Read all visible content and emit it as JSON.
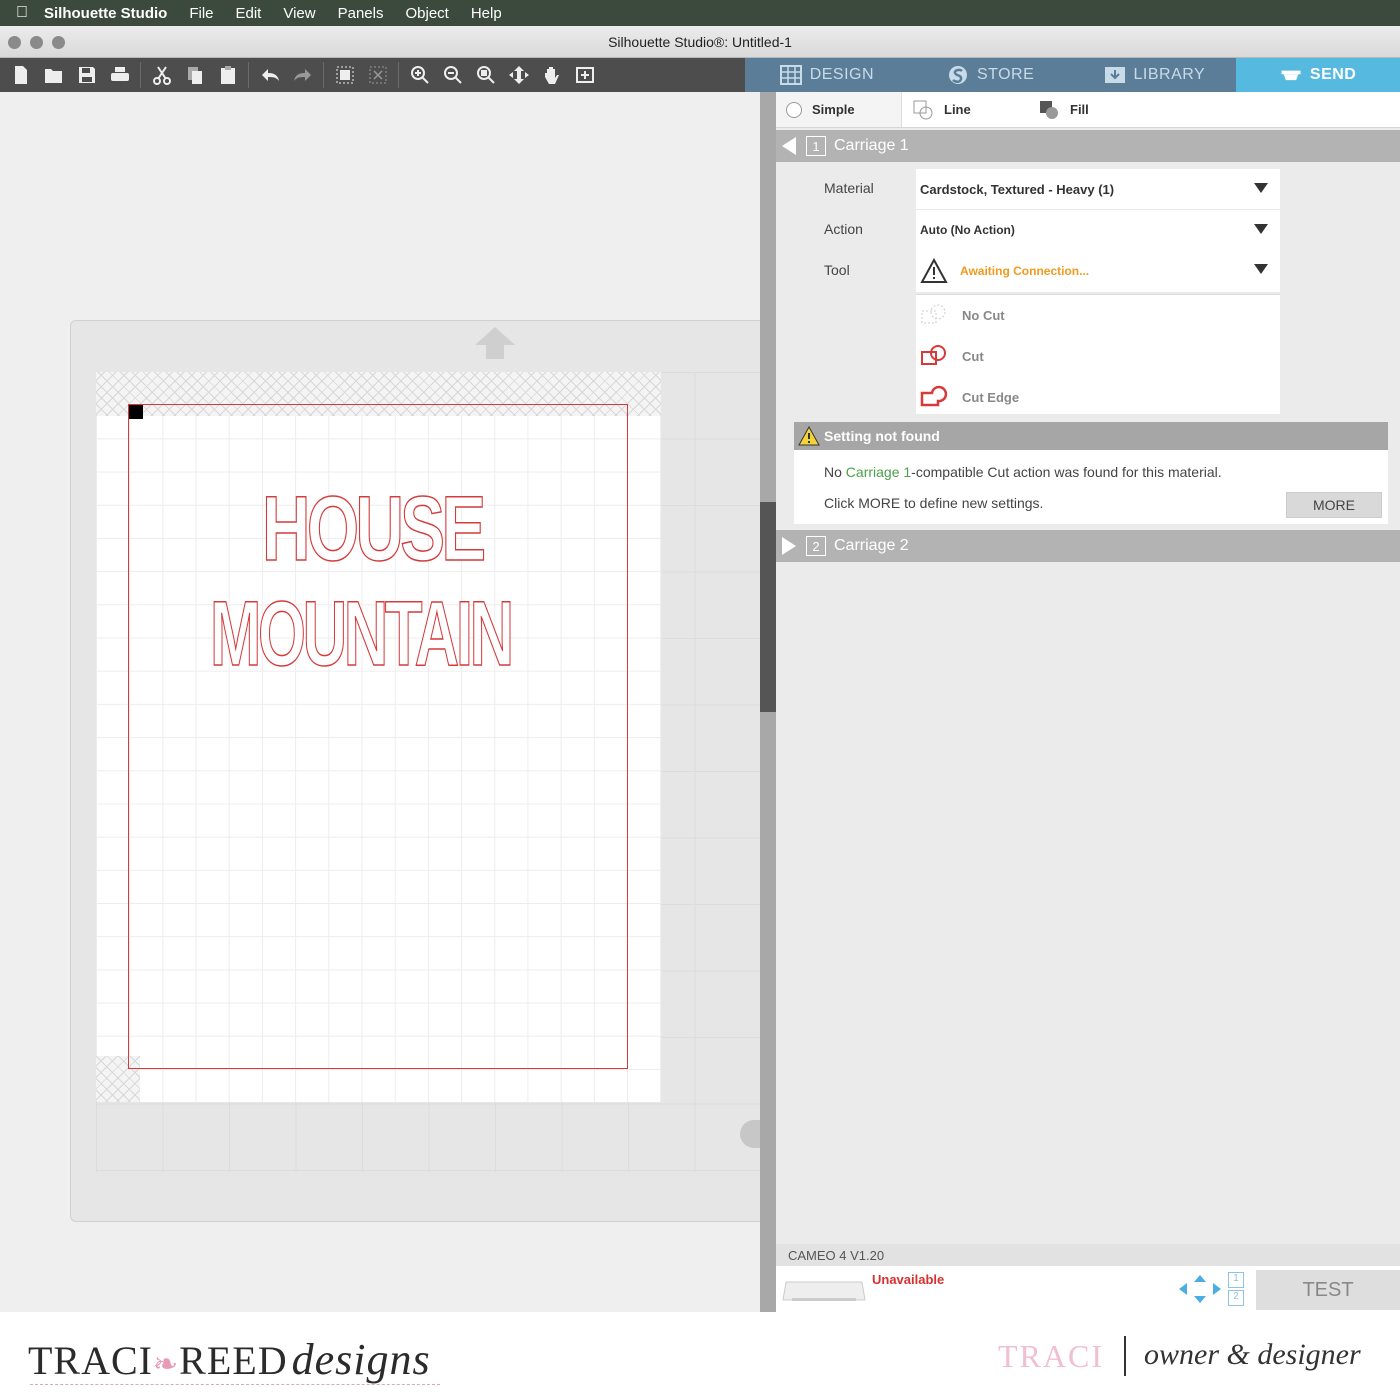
{
  "menubar": {
    "app_name": "Silhouette Studio",
    "items": [
      "File",
      "Edit",
      "View",
      "Panels",
      "Object",
      "Help"
    ]
  },
  "window": {
    "title": "Silhouette Studio®: Untitled-1"
  },
  "toolbar": {
    "icons": [
      "new-document-icon",
      "open-folder-icon",
      "save-icon",
      "print-icon",
      "cut-icon",
      "copy-icon",
      "paste-icon",
      "undo-icon",
      "redo-icon",
      "group-icon",
      "ungroup-icon",
      "zoom-in-icon",
      "zoom-out-icon",
      "zoom-fit-icon",
      "move-icon",
      "pan-hand-icon",
      "fit-page-icon"
    ]
  },
  "nav": {
    "tabs": [
      {
        "label": "DESIGN",
        "icon": "grid-icon",
        "active": false
      },
      {
        "label": "STORE",
        "icon": "store-s-icon",
        "active": false
      },
      {
        "label": "LIBRARY",
        "icon": "library-icon",
        "active": false
      },
      {
        "label": "SEND",
        "icon": "send-printer-icon",
        "active": true
      }
    ]
  },
  "canvas": {
    "design_text_line1": "HOUSE",
    "design_text_line2": "MOUNTAIN",
    "line_color": "#d43c3c"
  },
  "send_panel": {
    "modes": [
      {
        "label": "Simple",
        "selected": true
      },
      {
        "label": "Line",
        "selected": false
      },
      {
        "label": "Fill",
        "selected": false
      }
    ],
    "carriage1": {
      "number": "1",
      "title": "Carriage 1",
      "material_label": "Material",
      "material_value": "Cardstock, Textured - Heavy (1)",
      "action_label": "Action",
      "action_value": "Auto (No Action)",
      "tool_label": "Tool",
      "tool_value": "Awaiting Connection...",
      "tool_options": [
        "No Cut",
        "Cut",
        "Cut Edge"
      ]
    },
    "warning": {
      "title": "Setting not found",
      "line1_prefix": "No ",
      "line1_highlight": "Carriage 1",
      "line1_suffix": "-compatible Cut action was found for this material.",
      "line2": "Click MORE to define new settings.",
      "more_label": "MORE"
    },
    "carriage2": {
      "number": "2",
      "title": "Carriage 2"
    },
    "device": {
      "name": "CAMEO 4 V1.20",
      "status": "Unavailable",
      "carriage_numbers": [
        "1",
        "2"
      ],
      "test_label": "TEST"
    }
  },
  "footer": {
    "brand_left": "TRACI",
    "brand_mid": "REED",
    "brand_script": "designs",
    "signature": "TRACI",
    "role": "owner & designer"
  }
}
